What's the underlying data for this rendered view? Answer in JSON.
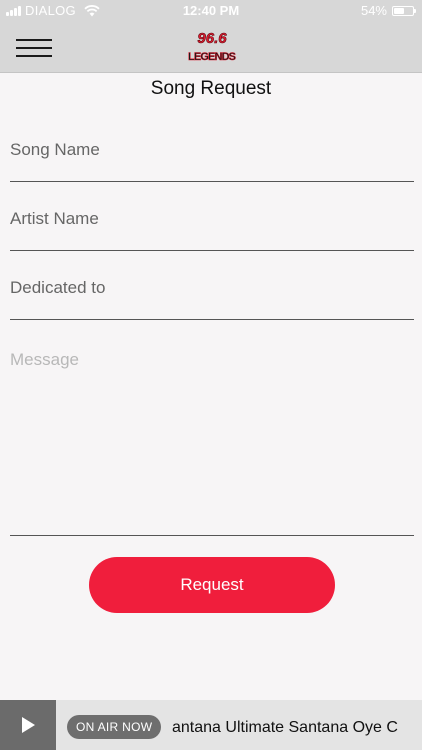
{
  "status_bar": {
    "carrier": "DIALOG",
    "time": "12:40 PM",
    "battery_text": "54%",
    "battery_level": 0.54
  },
  "header": {
    "menu_icon": "hamburger-menu-icon",
    "logo_text_top": "96.6",
    "logo_text_bottom": "LEGENDS"
  },
  "page": {
    "title": "Song Request"
  },
  "form": {
    "song_name_placeholder": "Song Name",
    "artist_name_placeholder": "Artist Name",
    "dedicated_to_placeholder": "Dedicated to",
    "message_placeholder": "Message",
    "submit_label": "Request"
  },
  "player": {
    "play_icon": "play-icon",
    "on_air_label": "ON AIR NOW",
    "now_playing": "antana Ultimate Santana   Oye C"
  },
  "colors": {
    "accent": "#f01e3c",
    "header_bg": "#d7d7d7",
    "page_bg": "#f7f5f6",
    "player_bg": "#e4e4e4"
  }
}
